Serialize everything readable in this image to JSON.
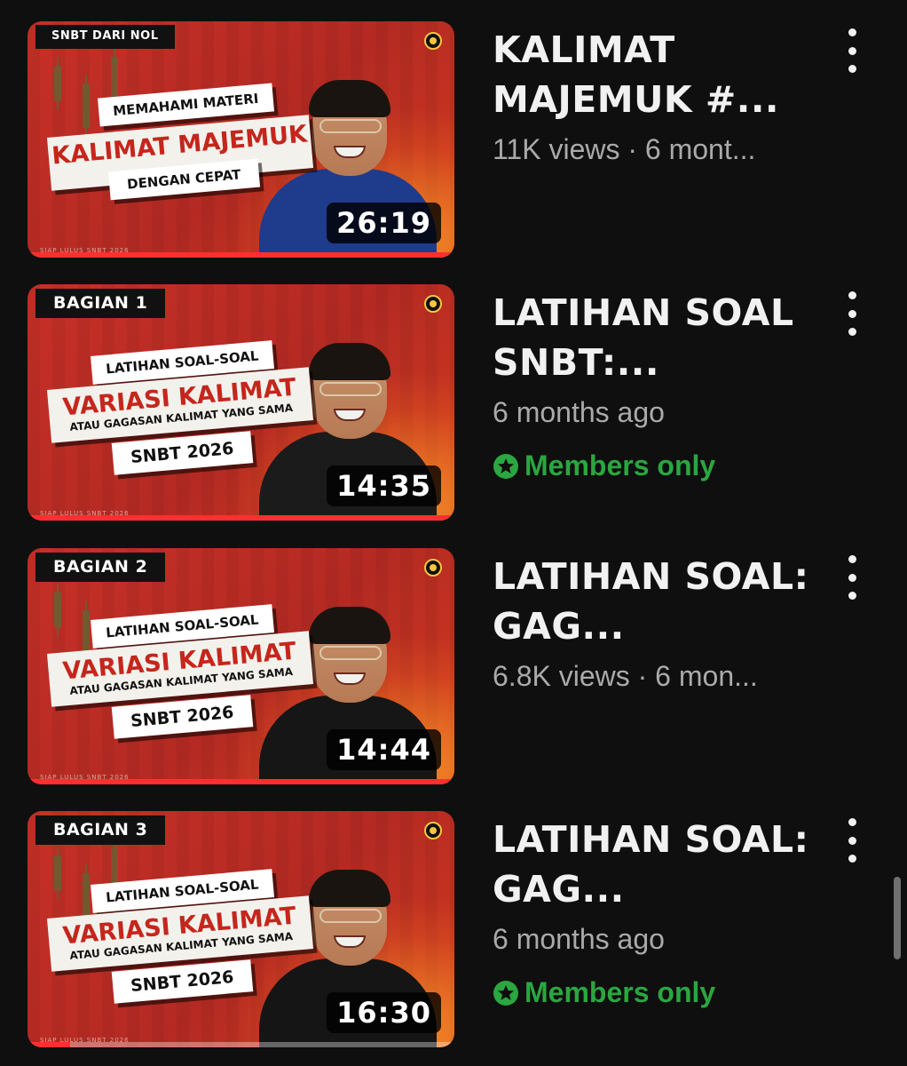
{
  "videos": [
    {
      "title": "KALIMAT MAJEMUK #...",
      "meta": "11K views · 6 mont...",
      "members_label": "",
      "duration": "26:19",
      "watched_fraction": 1.0,
      "thumbnail": {
        "tag": "SNBT DARI NOL",
        "card_top": "MEMAHAMI MATERI",
        "card_main": "KALIMAT MAJEMUK",
        "card_sub": "",
        "card_bottom": "DENGAN CEPAT",
        "footer": "SIAP LULUS SNBT 2026",
        "shirt_color": "#1f3b8c"
      }
    },
    {
      "title": "LATIHAN SOAL SNBT:...",
      "meta": "6 months ago",
      "members_label": "Members only",
      "duration": "14:35",
      "watched_fraction": 1.0,
      "thumbnail": {
        "tag": "BAGIAN 1",
        "card_top": "LATIHAN SOAL-SOAL",
        "card_main": "VARIASI KALIMAT",
        "card_sub": "ATAU GAGASAN KALIMAT YANG SAMA",
        "card_bottom": "SNBT 2026",
        "footer": "SIAP LULUS SNBT 2026",
        "shirt_color": "#1b1b1b"
      }
    },
    {
      "title": "LATIHAN SOAL: GAG...",
      "meta": "6.8K views · 6 mon...",
      "members_label": "",
      "duration": "14:44",
      "watched_fraction": 1.0,
      "thumbnail": {
        "tag": "BAGIAN 2",
        "card_top": "LATIHAN SOAL-SOAL",
        "card_main": "VARIASI KALIMAT",
        "card_sub": "ATAU GAGASAN KALIMAT YANG SAMA",
        "card_bottom": "SNBT 2026",
        "footer": "SIAP LULUS SNBT 2026",
        "shirt_color": "#161616"
      }
    },
    {
      "title": "LATIHAN SOAL: GAG...",
      "meta": "6 months ago",
      "members_label": "Members only",
      "duration": "16:30",
      "watched_fraction": 0.1,
      "thumbnail": {
        "tag": "BAGIAN 3",
        "card_top": "LATIHAN SOAL-SOAL",
        "card_main": "VARIASI KALIMAT",
        "card_sub": "ATAU GAGASAN KALIMAT YANG SAMA",
        "card_bottom": "SNBT 2026",
        "footer": "SIAP LULUS SNBT 2026",
        "shirt_color": "#151515"
      }
    }
  ],
  "colors": {
    "background": "#0f0f0f",
    "members_green": "#2ba640",
    "progress_red": "#ff2f2f",
    "meta_gray": "#aaaaaa"
  }
}
